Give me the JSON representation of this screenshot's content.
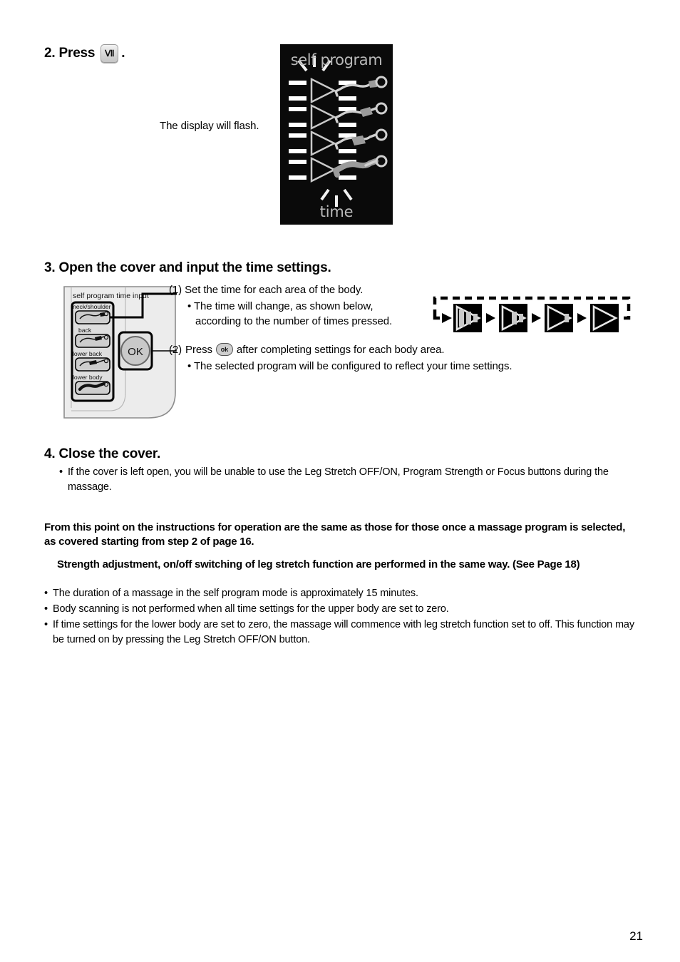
{
  "page": {
    "number": "21"
  },
  "step2": {
    "label": "2. Press",
    "key": "Ⅶ",
    "period": ".",
    "caption": "The display will flash."
  },
  "lcd": {
    "title": "self program",
    "time_label": "time",
    "rows": [
      {
        "name": "neck/shoulder",
        "highlight": "neck"
      },
      {
        "name": "back",
        "highlight": "back"
      },
      {
        "name": "lower back",
        "highlight": "lower-back"
      },
      {
        "name": "lower body",
        "highlight": "lower-body"
      }
    ]
  },
  "step3": {
    "heading": "3. Open the cover and input the time settings.",
    "panel": {
      "title": "self program time input",
      "buttons": [
        {
          "label": "neck/shoulder"
        },
        {
          "label": "back"
        },
        {
          "label": "lower back"
        },
        {
          "label": "lower body"
        }
      ],
      "ok_label": "OK"
    },
    "item1": {
      "number": "(1)",
      "text": "Set the time for each area of the body.",
      "sub_line1": "• The time will change, as shown below,",
      "sub_line2": "according to the number of times pressed."
    },
    "item2": {
      "number": "(2)",
      "text_before": "Press",
      "ok_label": "ok",
      "text_after": "after completing settings for each body area.",
      "sub": "• The selected program will be configured to reflect your time settings."
    },
    "timeline": {
      "steps": [
        {
          "segments": 3
        },
        {
          "segments": 2
        },
        {
          "segments": 1
        },
        {
          "segments": 0
        }
      ],
      "arrow": "▶"
    }
  },
  "step4": {
    "heading": "4. Close the cover.",
    "bullet_dot": "•",
    "bullet": "If the cover is left open, you will be unable to use the Leg Stretch OFF/ON, Program Strength or Focus buttons during the massage."
  },
  "notes": {
    "para1": "From this point on the instructions for operation are the same as those for those once a massage program is selected, as covered starting from step 2 of page 16.",
    "para2": "Strength adjustment, on/off switching of leg stretch function are performed in the same way. (See Page 18)"
  },
  "final_bullets": {
    "dot": "•",
    "items": [
      "The duration of a massage in the self program mode is approximately 15 minutes.",
      "Body scanning is not performed when all time settings for the upper body are set to zero.",
      "If time settings for the lower body are set to zero, the massage will commence with leg stretch function set to off. This function may be turned on by pressing the Leg Stretch OFF/ON button."
    ]
  },
  "colors": {
    "lcd_background": "#0a0a0a",
    "lcd_foreground": "#b9b9b9",
    "panel_face": "#e8e8e8",
    "button_face": "#d4d4d4"
  }
}
